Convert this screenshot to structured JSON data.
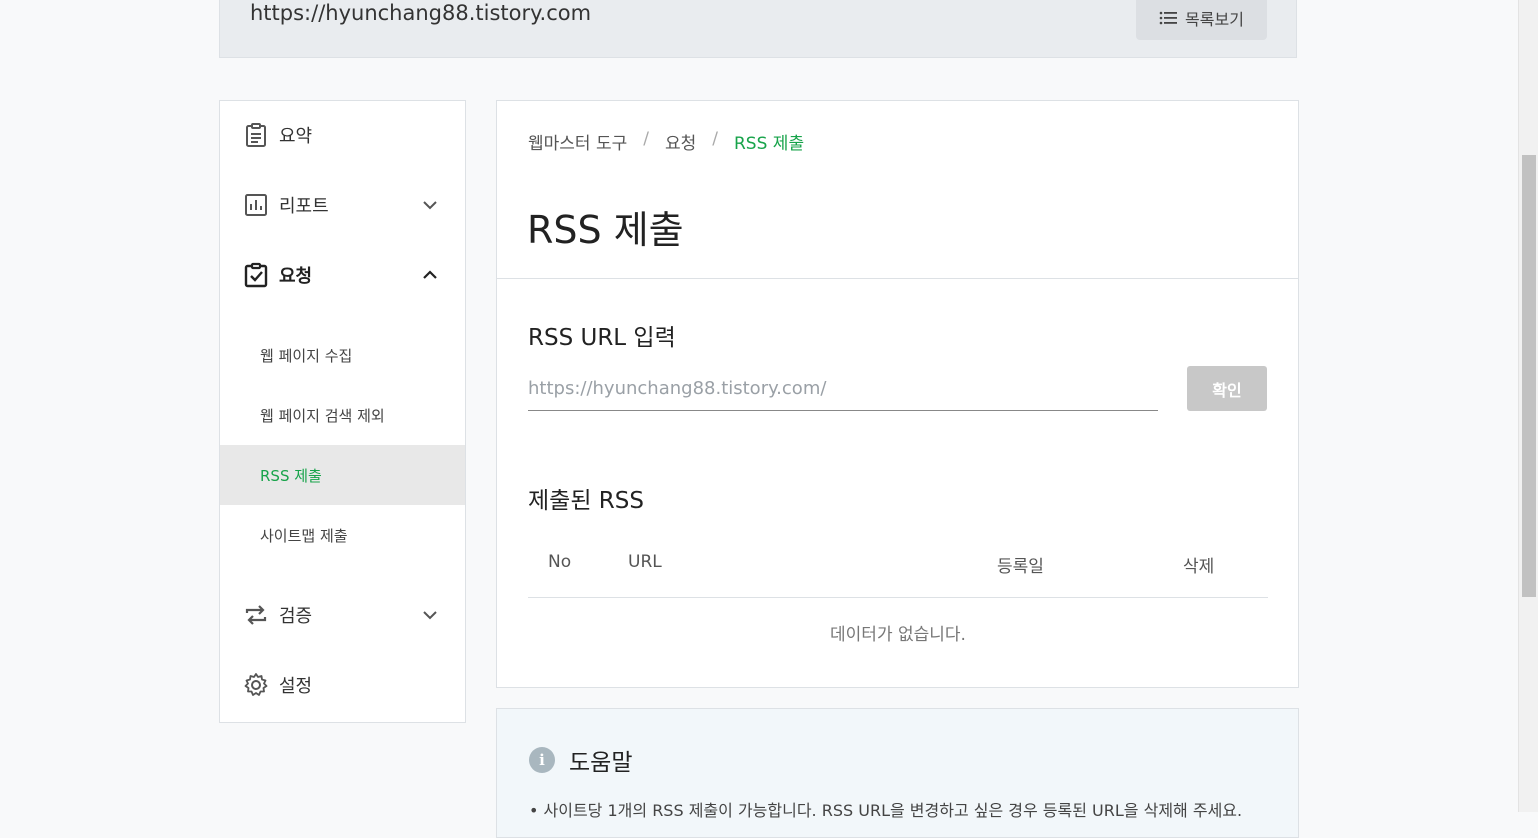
{
  "site": {
    "url": "https://hyunchang88.tistory.com",
    "list_button": "목록보기"
  },
  "sidebar": {
    "summary": "요약",
    "report": "리포트",
    "request": "요청",
    "request_items": [
      "웹 페이지 수집",
      "웹 페이지 검색 제외",
      "RSS 제출",
      "사이트맵 제출"
    ],
    "verify": "검증",
    "settings": "설정"
  },
  "breadcrumb": {
    "root": "웹마스터 도구",
    "sep": "/",
    "section": "요청",
    "current": "RSS 제출"
  },
  "main": {
    "title": "RSS 제출",
    "input_section": "RSS URL 입력",
    "input_placeholder": "https://hyunchang88.tistory.com/",
    "confirm": "확인",
    "submitted_title": "제출된 RSS",
    "table": {
      "col_no": "No",
      "col_url": "URL",
      "col_date": "등록일",
      "col_delete": "삭제",
      "empty": "데이터가 없습니다."
    }
  },
  "help": {
    "title": "도움말",
    "icon": "i",
    "text": "• 사이트당 1개의 RSS 제출이 가능합니다. RSS URL을 변경하고 싶은 경우 등록된 URL을 삭제해 주세요."
  },
  "colors": {
    "accent": "#17a34a",
    "button_disabled": "#c8c8c8"
  }
}
